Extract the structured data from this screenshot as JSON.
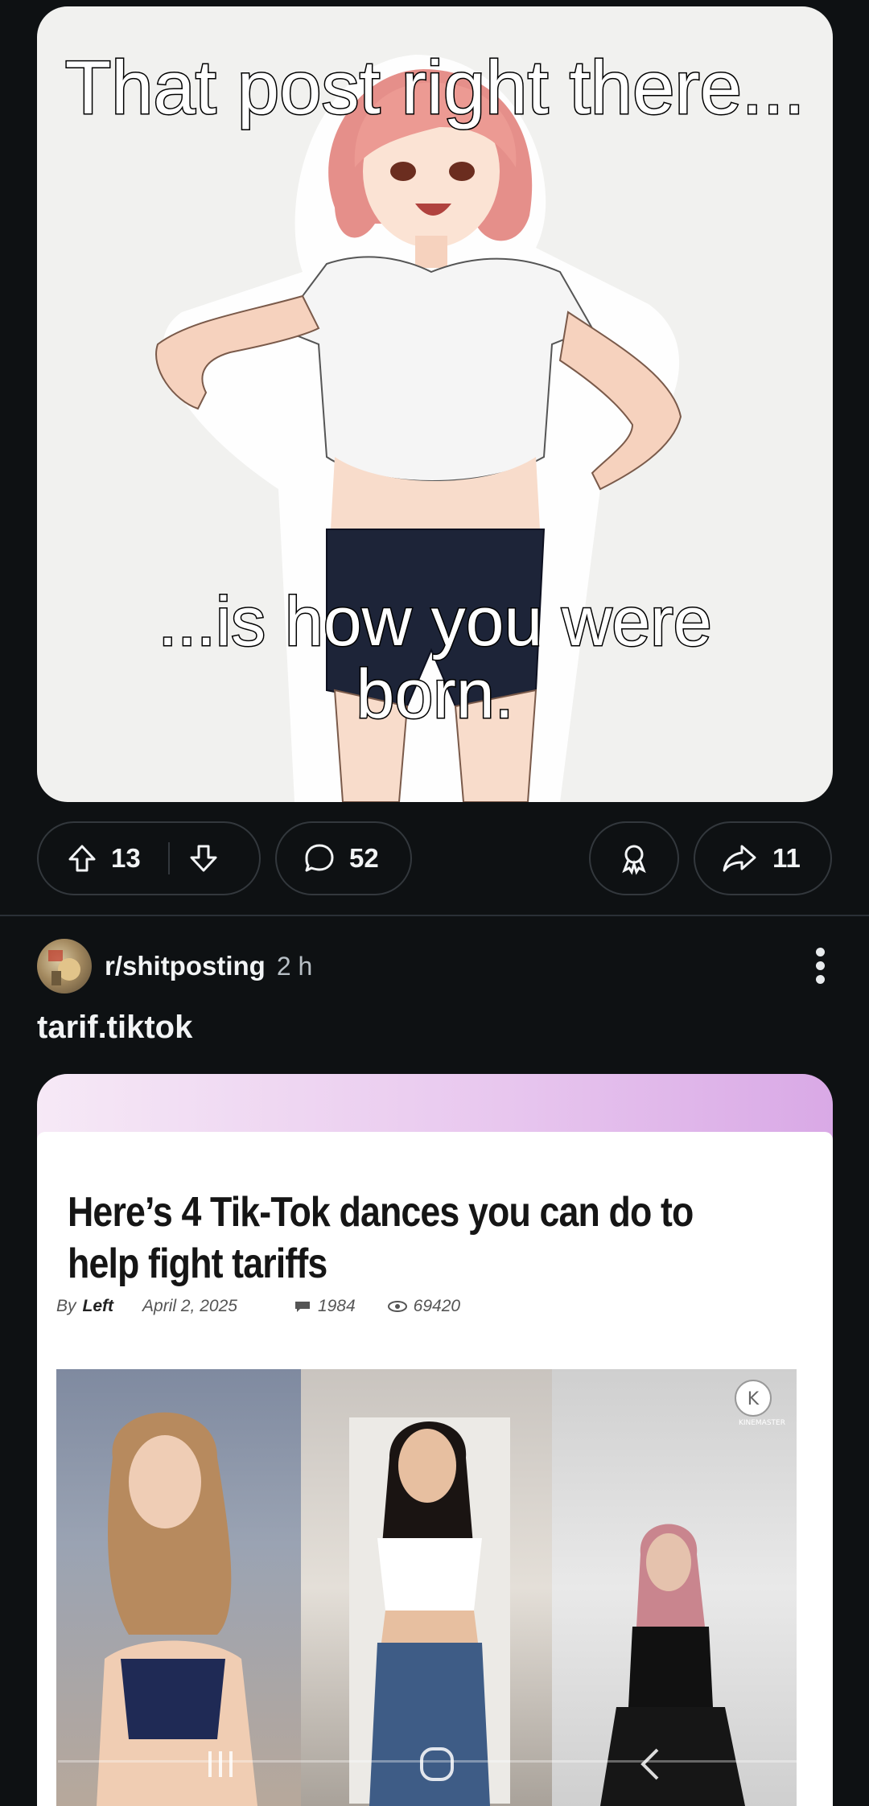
{
  "post1": {
    "meme_top_text": "That post right there...",
    "meme_bottom_text": "...is how you were born.",
    "upvotes": "13",
    "comments": "52",
    "shares": "11"
  },
  "post2": {
    "subreddit": "r/shitposting",
    "time": "2 h",
    "title": "tarif.tiktok",
    "image": {
      "headline": "Here’s 4 Tik-Tok dances you can do to help fight tariffs",
      "by": "By",
      "author": "Left",
      "date": "April 2, 2025",
      "comments": "1984",
      "views": "69420",
      "watermark": "KINEMASTER"
    }
  },
  "icons": {
    "upvote": "arrow-up-icon",
    "downvote": "arrow-down-icon",
    "comment": "speech-bubble-icon",
    "award": "award-ribbon-icon",
    "share": "share-arrow-icon",
    "more": "vertical-dots-icon"
  },
  "colors": {
    "background": "#0e1113",
    "pill_border": "#33383d",
    "text": "#f2f4f5",
    "muted": "#b7bfc5"
  }
}
